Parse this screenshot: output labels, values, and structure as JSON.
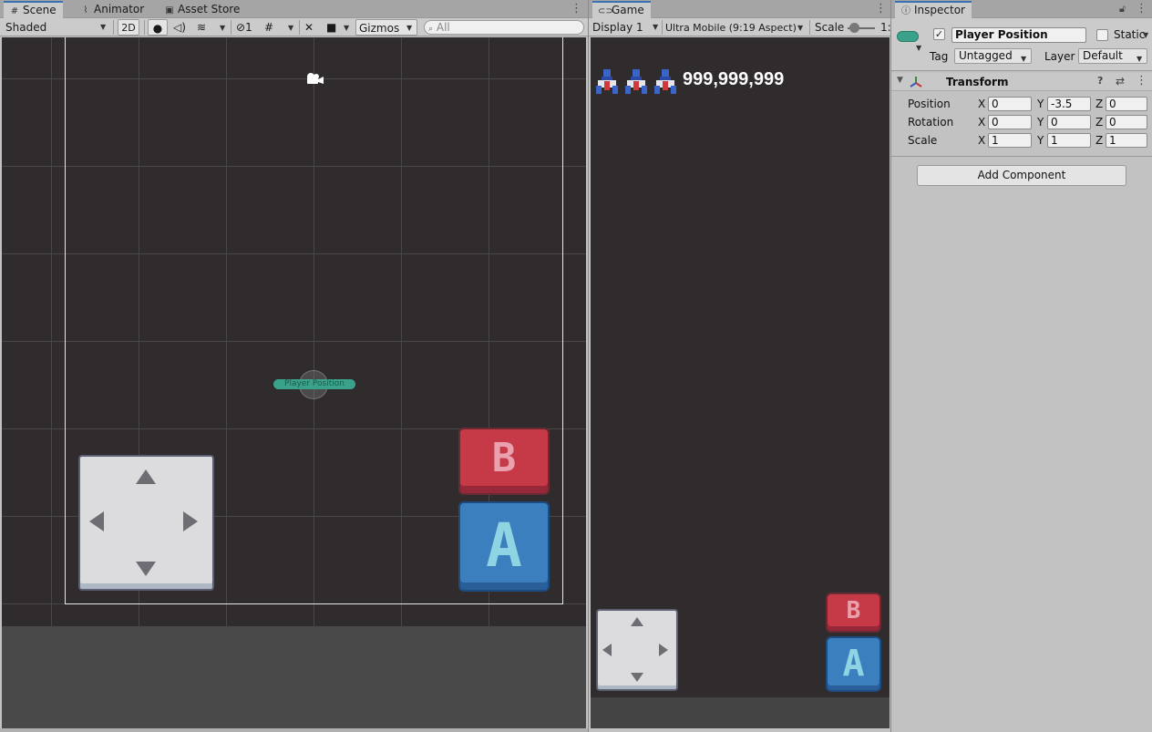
{
  "scene_panel": {
    "tabs": [
      {
        "label": "Scene",
        "icon": "hash-icon"
      },
      {
        "label": "Animator",
        "icon": "animator-icon"
      },
      {
        "label": "Asset Store",
        "icon": "lock-icon"
      }
    ],
    "toolbar": {
      "draw_mode": "Shaded",
      "mode_2d": "2D",
      "hidden_count": "1",
      "gizmos": "Gizmos",
      "search_placeholder": "All"
    },
    "object_label": "Player Position"
  },
  "game_panel": {
    "tab_label": "Game",
    "toolbar": {
      "display": "Display 1",
      "aspect": "Ultra Mobile (9:19 Aspect)",
      "scale_label": "Scale",
      "scale_value": "1:"
    },
    "score": "999,999,999",
    "lives": 3
  },
  "controls": {
    "b_label": "B",
    "a_label": "A"
  },
  "inspector": {
    "tab_label": "Inspector",
    "object_name": "Player Position",
    "active": true,
    "static_label": "Static",
    "tag_label": "Tag",
    "tag_value": "Untagged",
    "layer_label": "Layer",
    "layer_value": "Default",
    "transform": {
      "title": "Transform",
      "rows": [
        {
          "label": "Position",
          "x": "0",
          "y": "-3.5",
          "z": "0"
        },
        {
          "label": "Rotation",
          "x": "0",
          "y": "0",
          "z": "0"
        },
        {
          "label": "Scale",
          "x": "1",
          "y": "1",
          "z": "1"
        }
      ],
      "axis_x": "X",
      "axis_y": "Y",
      "axis_z": "Z"
    },
    "add_component": "Add Component"
  },
  "colors": {
    "accent": "#3a72b0",
    "scene_bg": "#302c2d",
    "object_label_bg": "#3aa28a",
    "b_button": "#c63a47",
    "a_button": "#3c7fbf"
  }
}
